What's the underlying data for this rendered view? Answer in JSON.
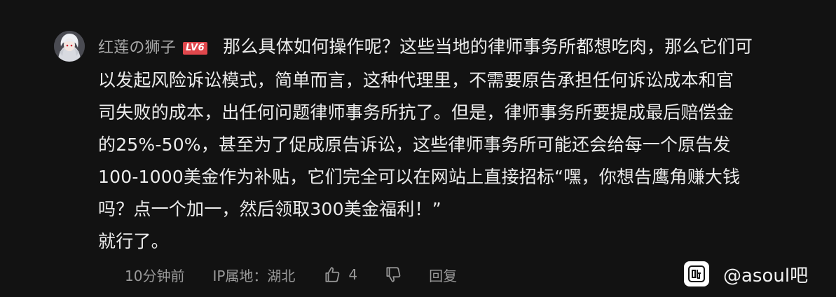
{
  "comment": {
    "username": "红莲の狮子",
    "level": "LV6",
    "lines": [
      "那么具体如何操作呢？这些当地的律师事务所都想吃肉，那么它们可",
      "以发起风险诉讼模式，简单而言，这种代理里，不需要原告承担任何诉讼成本和官",
      "司失败的成本，出任何问题律师事务所抗了。但是，律师事务所要提成最后赔偿金",
      "的25%-50%，甚至为了促成原告诉讼，这些律师事务所可能还会给每一个原告发",
      "100-1000美金作为补贴，它们完全可以在网站上直接招标“嘿，你想告鹰角赚大钱",
      "吗？点一个加一，然后领取300美金福利！”",
      "就行了。"
    ]
  },
  "meta": {
    "time": "10分钟前",
    "ip": "IP属地：湖北",
    "like_count": "4",
    "reply_label": "回复"
  },
  "watermark": {
    "text": "@asoul吧",
    "logo_text": "贴"
  },
  "icons": {
    "like": "thumbs-up-icon",
    "dislike": "thumbs-down-icon",
    "logo": "tieba-logo-icon"
  },
  "colors": {
    "background": "#121212",
    "level_badge": "#e0474c",
    "username": "#a9a9a9",
    "meta": "#9a9a9a"
  }
}
